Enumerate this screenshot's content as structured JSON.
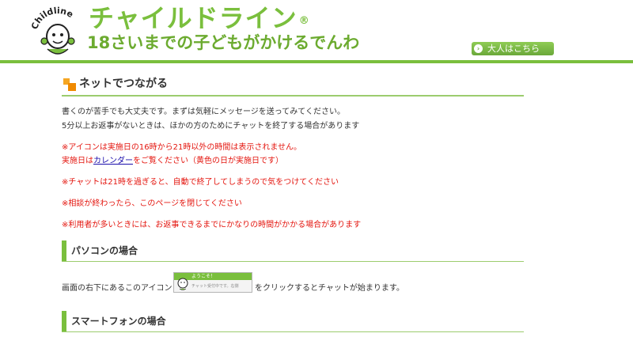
{
  "header": {
    "title": "チャイルドライン",
    "reg_mark": "®",
    "subtitle": "18さいまでの子どもがかけるでんわ",
    "logo_arc_text": "Childline",
    "adult_button": "大人はこちら"
  },
  "main": {
    "section_title": "ネットでつながる",
    "intro": [
      "書くのが苦手でも大丈夫です。まずは気軽にメッセージを送ってみてください。",
      "5分以上お返事がないときは、ほかの方のためにチャットを終了する場合があります"
    ],
    "notice_icon": "※アイコンは実施日の16時から21時以外の時間は表示されません。",
    "notice_calendar": {
      "prefix": "実施日は",
      "link": "カレンダー",
      "suffix": "をご覧ください（黄色の日が実施日です）"
    },
    "notice_chat": "※チャットは21時を過ぎると、自動で終了してしまうので気をつけてください",
    "notice_close": "※相談が終わったら、このページを閉じてください",
    "notice_busy": "※利用者が多いときには、お返事できるまでにかなりの時間がかかる場合があります",
    "pc": {
      "title": "パソコンの場合",
      "text_before": "画面の右下にあるこのアイコン",
      "text_after": "をクリックするとチャットが始まります。",
      "icon_header": "ようこそ！",
      "icon_body": "チャット受付中です。右側"
    },
    "sp": {
      "title": "スマートフォンの場合"
    }
  },
  "colors": {
    "brand_green": "#7abf3d",
    "notice_red": "#e4160f",
    "accent_orange": "#f08a00"
  }
}
